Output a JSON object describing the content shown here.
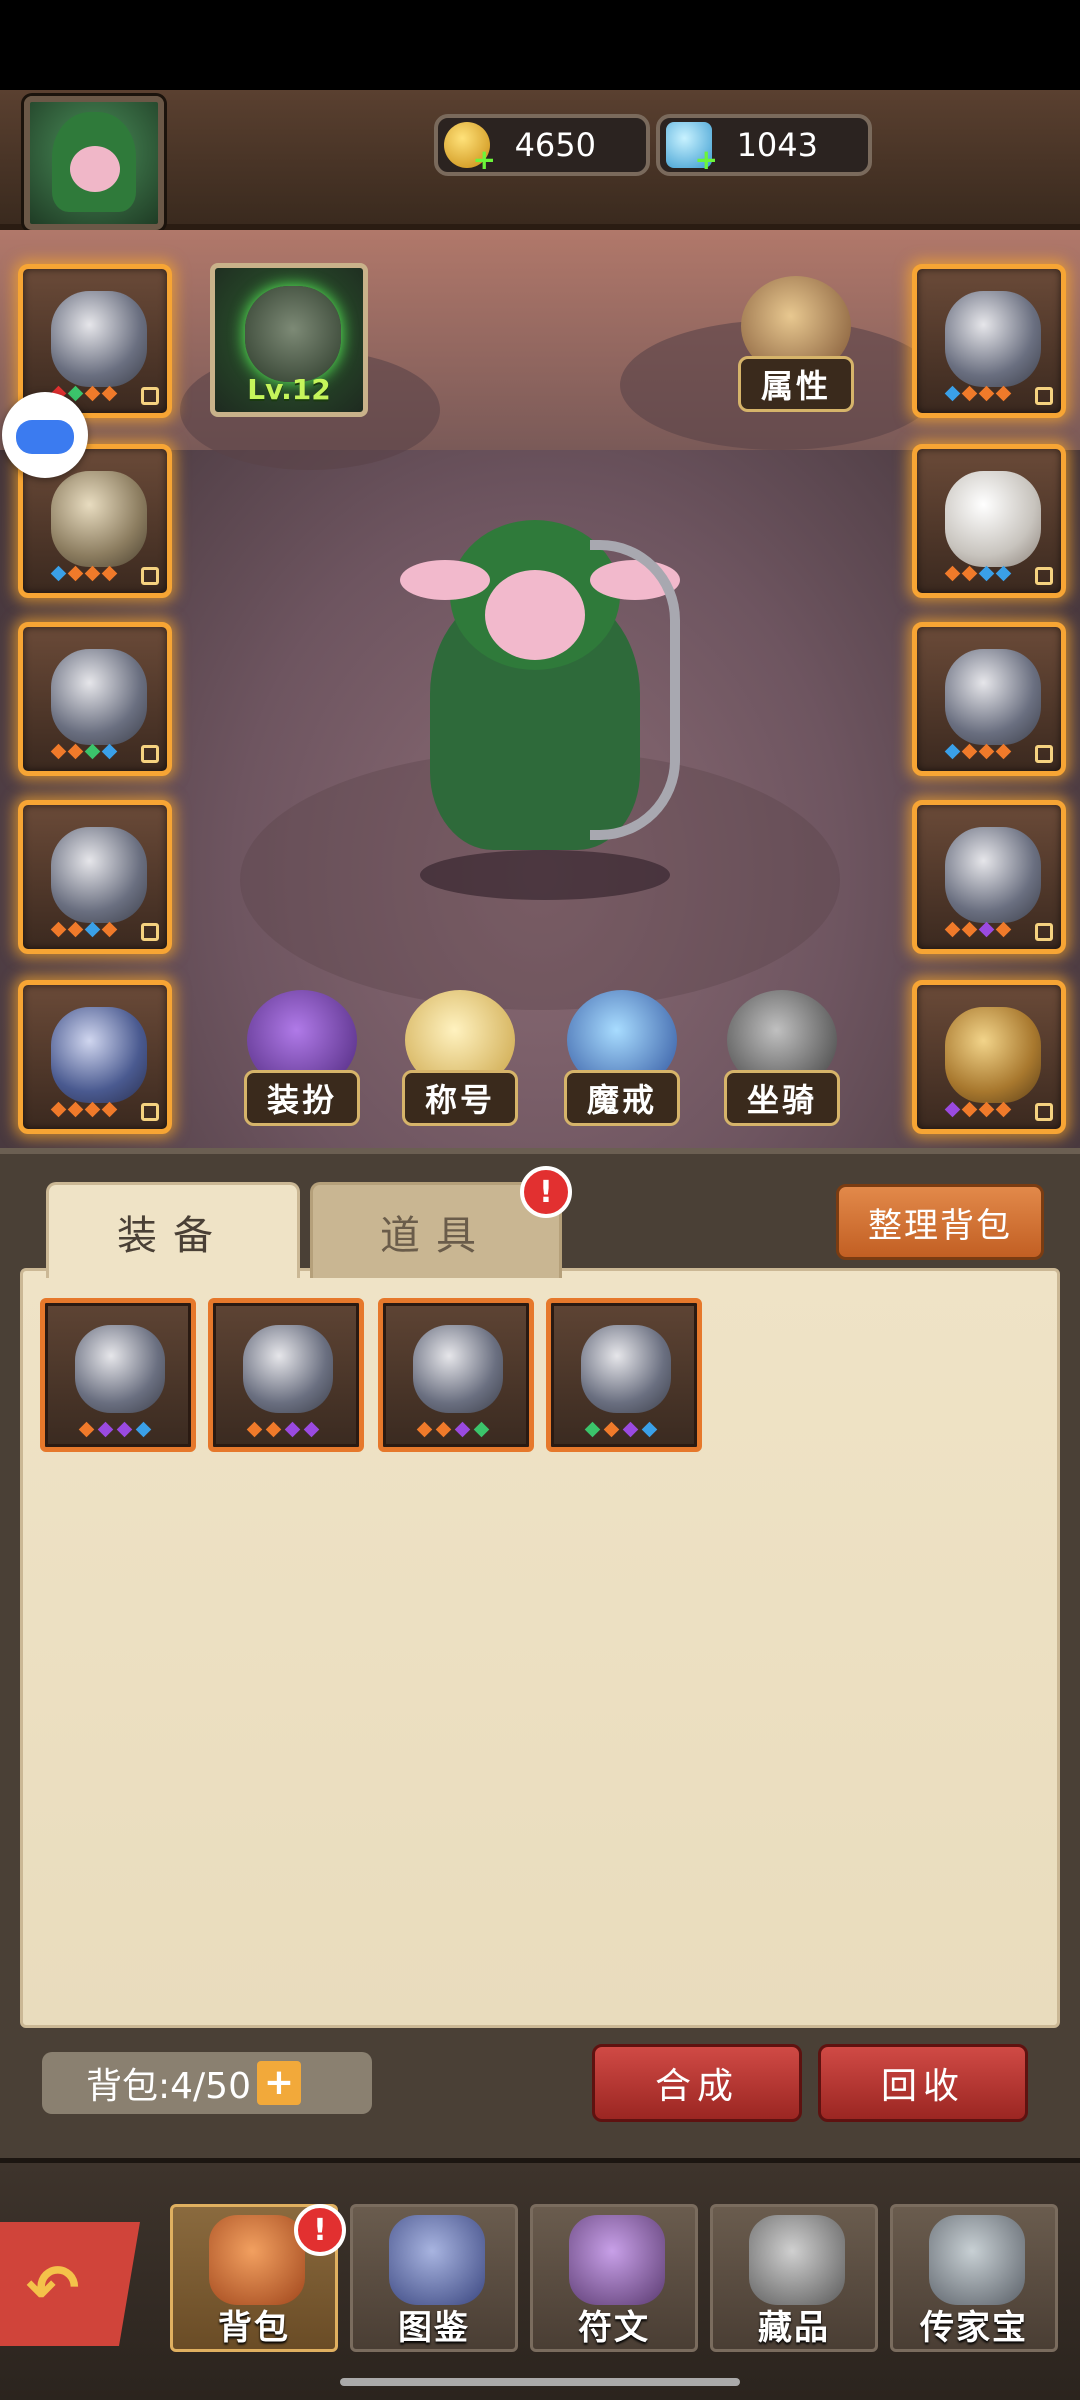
{
  "currency": {
    "gold": "4650",
    "gems": "1043"
  },
  "hero": {
    "level": "Lv.12"
  },
  "scene_buttons": {
    "attributes": "属性",
    "outfit": "装扮",
    "title": "称号",
    "magic_ring": "魔戒",
    "mount": "坐骑"
  },
  "tabs": {
    "equipment": "装备",
    "items": "道具",
    "items_badge": "!"
  },
  "sort_button": "整理背包",
  "capacity": {
    "label": "背包:4/50",
    "plus": "+"
  },
  "actions": {
    "combine": "合成",
    "recycle": "回收"
  },
  "nav": {
    "back_icon": "back-arrow-icon",
    "bag": "背包",
    "bag_badge": "!",
    "codex": "图鉴",
    "runes": "符文",
    "collection": "藏品",
    "heirloom": "传家宝"
  },
  "colors": {
    "slot_glow": "#f7a534",
    "bag_slot_border": "#e6782b",
    "action_red": "#c13a35",
    "sort_orange": "#d5763a",
    "badge_red": "#e23030"
  }
}
